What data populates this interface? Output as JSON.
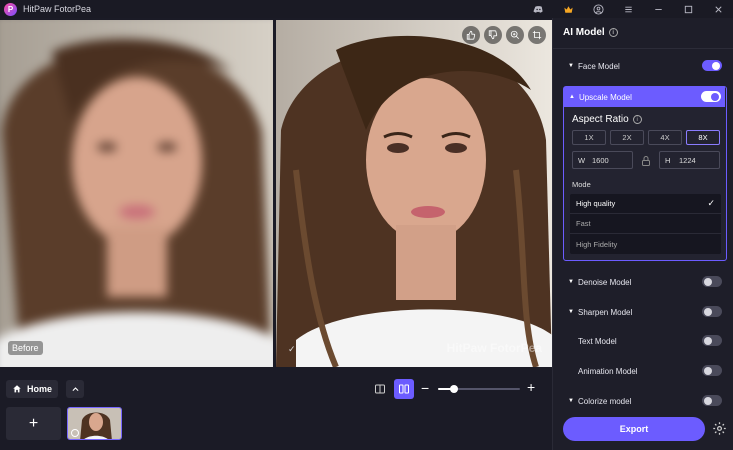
{
  "app": {
    "title": "HitPaw FotorPea",
    "logo_letter": "P"
  },
  "titlebar": {
    "icons": [
      "discord-icon",
      "crown-icon",
      "account-icon",
      "menu-icon",
      "minimize-icon",
      "maximize-icon",
      "close-icon"
    ]
  },
  "preview": {
    "before_label": "Before",
    "after_check": "✓",
    "watermark": "HitPaw FotorPea"
  },
  "bottom": {
    "home_label": "Home",
    "add_label": "+",
    "zoom_minus": "−",
    "zoom_plus": "+",
    "zoom_level": 0.2
  },
  "panel": {
    "title": "AI Model",
    "models": [
      {
        "label": "Face Model",
        "caret": "▼",
        "on": true
      },
      {
        "label": "Upscale Model",
        "caret": "▲",
        "on": true
      },
      {
        "label": "Denoise Model",
        "caret": "▼",
        "on": false
      },
      {
        "label": "Sharpen Model",
        "caret": "▼",
        "on": false
      },
      {
        "label": "Text Model",
        "caret": "",
        "on": false
      },
      {
        "label": "Animation Model",
        "caret": "",
        "on": false
      },
      {
        "label": "Colorize model",
        "caret": "▼",
        "on": false
      }
    ],
    "upscale": {
      "aspect_title": "Aspect Ratio",
      "ratios": [
        "1X",
        "2X",
        "4X",
        "8X"
      ],
      "selected_ratio": "8X",
      "width_label": "W",
      "width_value": "1600",
      "height_label": "H",
      "height_value": "1224",
      "mode_label": "Mode",
      "modes": [
        "High quality",
        "Fast",
        "High Fidelity"
      ],
      "selected_mode": "High quality"
    },
    "export_label": "Export"
  },
  "colors": {
    "accent": "#6c5cff",
    "background": "#1b1b26",
    "panel": "#1e1e29"
  }
}
